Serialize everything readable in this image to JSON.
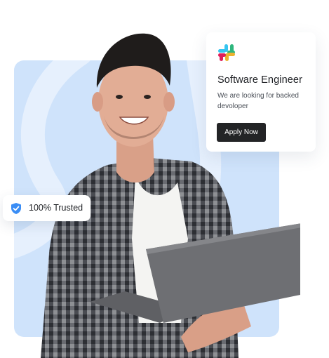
{
  "job_card": {
    "logo_icon": "slack-logo-icon",
    "title": "Software Engineer",
    "description": "We are looking for backed devoloper",
    "apply_label": "Apply Now"
  },
  "trust_badge": {
    "icon": "shield-check-icon",
    "label": "100% Trusted"
  },
  "colors": {
    "panel_background": "#cfe3fb",
    "button_dark": "#232426",
    "shield_blue": "#3a8df5"
  }
}
